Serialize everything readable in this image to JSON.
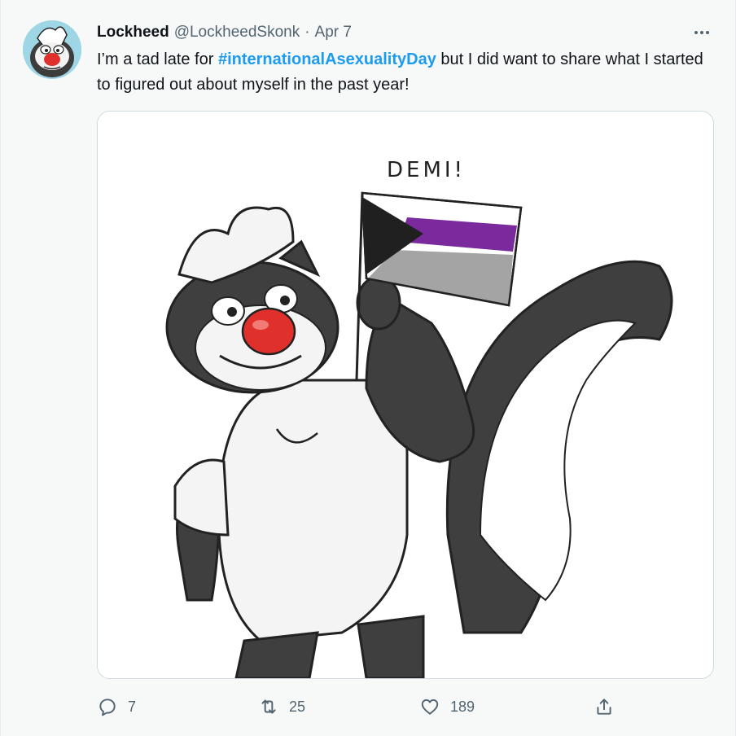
{
  "tweet": {
    "author_name": "Lockheed",
    "author_handle": "@LockheedSkonk",
    "separator": "·",
    "date": "Apr 7",
    "text_before": "I’m a tad late for ",
    "hashtag": "#internationalAsexualityDay",
    "text_after": " but I did want to share what I started to figured out about myself in the past year!"
  },
  "image": {
    "alt_sign_text": "DEMI!"
  },
  "actions": {
    "reply_count": "7",
    "retweet_count": "25",
    "like_count": "189"
  },
  "colors": {
    "hashtag": "#1d9bf0",
    "secondary_text": "#536471",
    "flag_purple": "#7b2a9e",
    "flag_gray": "#a4a4a4",
    "flag_black": "#202020",
    "nose_red": "#e0302b"
  },
  "icons": [
    "more-icon",
    "reply-icon",
    "retweet-icon",
    "like-icon",
    "share-icon"
  ]
}
